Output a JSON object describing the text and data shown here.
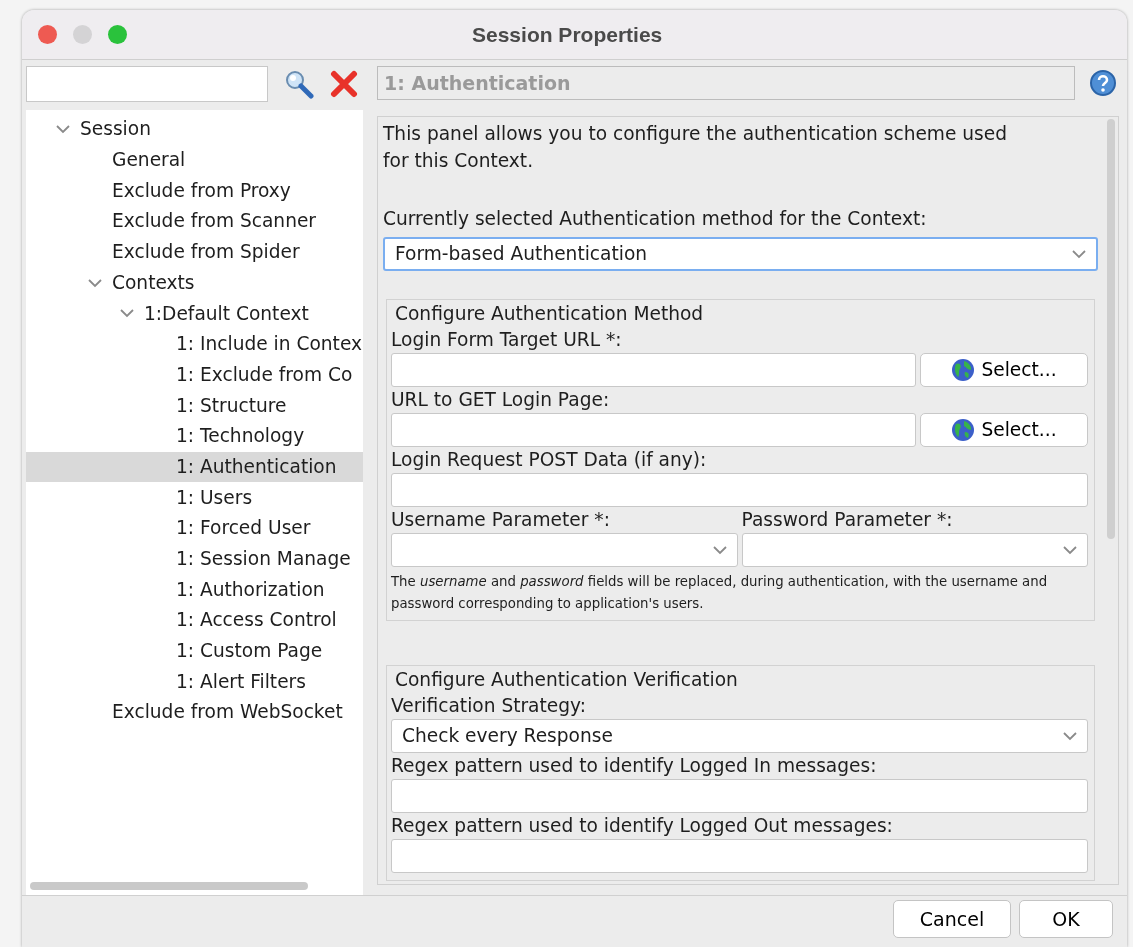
{
  "window": {
    "title": "Session Properties"
  },
  "tree": [
    {
      "label": "Session",
      "expanded": true,
      "selected": false,
      "children": [
        {
          "label": "General",
          "selected": false
        },
        {
          "label": "Exclude from Proxy",
          "selected": false
        },
        {
          "label": "Exclude from Scanner",
          "selected": false
        },
        {
          "label": "Exclude from Spider",
          "selected": false
        },
        {
          "label": "Contexts",
          "expanded": true,
          "selected": false,
          "children": [
            {
              "label": "1:Default Context",
              "expanded": true,
              "selected": false,
              "children": [
                {
                  "label": "1: Include in Contex",
                  "selected": false
                },
                {
                  "label": "1: Exclude from Co",
                  "selected": false
                },
                {
                  "label": "1: Structure",
                  "selected": false
                },
                {
                  "label": "1: Technology",
                  "selected": false
                },
                {
                  "label": "1: Authentication",
                  "selected": true
                },
                {
                  "label": "1: Users",
                  "selected": false
                },
                {
                  "label": "1: Forced User",
                  "selected": false
                },
                {
                  "label": "1: Session Manage",
                  "selected": false
                },
                {
                  "label": "1: Authorization",
                  "selected": false
                },
                {
                  "label": "1: Access Control",
                  "selected": false
                },
                {
                  "label": "1: Custom Page",
                  "selected": false
                },
                {
                  "label": "1: Alert Filters",
                  "selected": false
                }
              ]
            }
          ]
        },
        {
          "label": "Exclude from WebSocket",
          "selected": false
        }
      ]
    }
  ],
  "panel": {
    "title": "1: Authentication",
    "description": "This panel allows you to configure the authentication scheme used for this Context.",
    "method_label": "Currently selected Authentication method for the Context:",
    "method_value": "Form-based Authentication",
    "groups": [
      {
        "title": "Configure Authentication Method",
        "fields": [
          {
            "kind": "url",
            "label": "Login Form Target URL *:",
            "button": "Select..."
          },
          {
            "kind": "url",
            "label": "URL to GET Login Page:",
            "button": "Select..."
          },
          {
            "kind": "text",
            "label": "Login Request POST Data (if any):"
          },
          {
            "kind": "pair",
            "labels": [
              "Username Parameter *:",
              "Password Parameter *:"
            ]
          },
          {
            "kind": "note",
            "text": "The *username* and *password* fields will be replaced, during authentication, with the username and password corresponding to application's users."
          }
        ]
      },
      {
        "title": "Configure Authentication Verification",
        "fields": [
          {
            "kind": "combo",
            "label": "Verification Strategy:",
            "value": "Check every Response"
          },
          {
            "kind": "text",
            "label": "Regex pattern used to identify Logged In messages:"
          },
          {
            "kind": "text",
            "label": "Regex pattern used to identify Logged Out messages:"
          }
        ]
      }
    ]
  },
  "buttons": [
    "Cancel",
    "OK"
  ]
}
